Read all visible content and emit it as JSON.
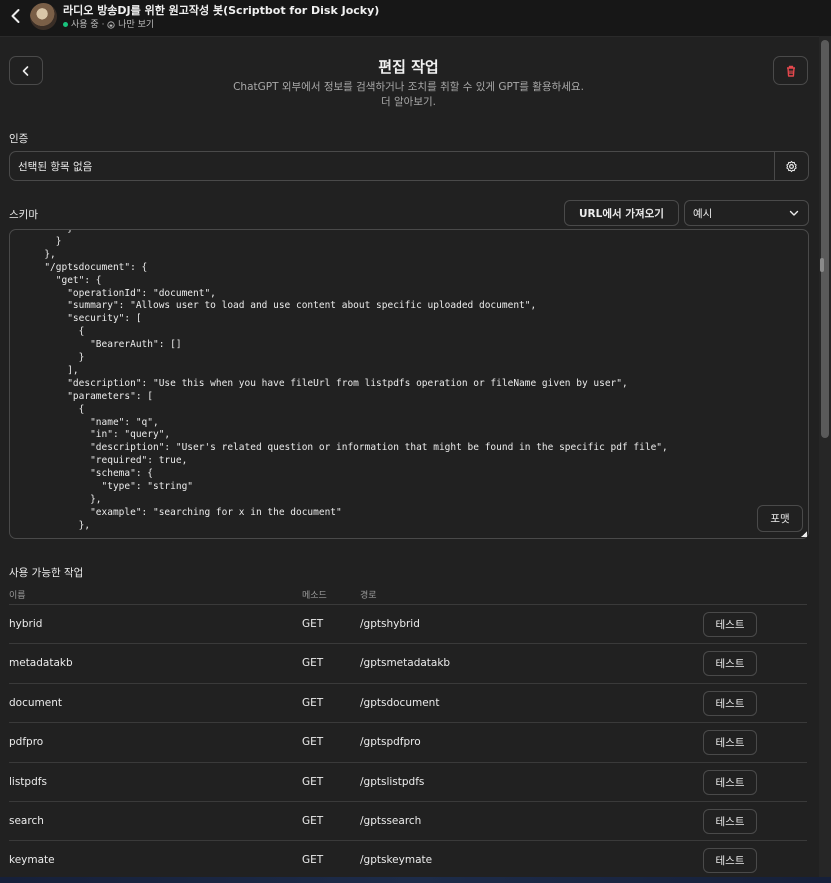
{
  "topbar": {
    "title": "라디오 방송DJ를 위한 원고작성 봇(Scriptbot for Disk Jocky)",
    "status": "사용 중",
    "visibility": "나만 보기",
    "status_color": "#19c37d"
  },
  "header": {
    "title": "편집 작업",
    "subtitle": "ChatGPT 외부에서 정보를 검색하거나 조치를 취할 수 있게 GPT를 활용하세요.",
    "learn_more": "더 알아보기."
  },
  "auth": {
    "label": "인증",
    "value": "선택된 항목 없음"
  },
  "schema": {
    "label": "스키마",
    "import_url_label": "URL에서 가져오기",
    "example_select_value": "예시",
    "format_label": "포맷",
    "code_lines": [
      "          }",
      "        }",
      "      },",
      "      \"/gptsdocument\": {",
      "        \"get\": {",
      "          \"operationId\": \"document\",",
      "          \"summary\": \"Allows user to load and use content about specific uploaded document\",",
      "          \"security\": [",
      "            {",
      "              \"BearerAuth\": []",
      "            }",
      "          ],",
      "          \"description\": \"Use this when you have fileUrl from listpdfs operation or fileName given by user\",",
      "          \"parameters\": [",
      "            {",
      "              \"name\": \"q\",",
      "              \"in\": \"query\",",
      "              \"description\": \"User's related question or information that might be found in the specific pdf file\",",
      "              \"required\": true,",
      "              \"schema\": {",
      "                \"type\": \"string\"",
      "              },",
      "              \"example\": \"searching for x in the document\"",
      "            },"
    ]
  },
  "actions": {
    "label": "사용 가능한 작업",
    "columns": [
      "이름",
      "메소드",
      "경로"
    ],
    "test_label": "테스트",
    "rows": [
      {
        "name": "hybrid",
        "method": "GET",
        "path": "/gptshybrid"
      },
      {
        "name": "metadatakb",
        "method": "GET",
        "path": "/gptsmetadatakb"
      },
      {
        "name": "document",
        "method": "GET",
        "path": "/gptsdocument"
      },
      {
        "name": "pdfpro",
        "method": "GET",
        "path": "/gptspdfpro"
      },
      {
        "name": "listpdfs",
        "method": "GET",
        "path": "/gptslistpdfs"
      },
      {
        "name": "search",
        "method": "GET",
        "path": "/gptssearch"
      },
      {
        "name": "keymate",
        "method": "GET",
        "path": "/gptskeymate"
      }
    ]
  },
  "colors": {
    "background": "#212121",
    "delete_icon": "#e5484d"
  }
}
